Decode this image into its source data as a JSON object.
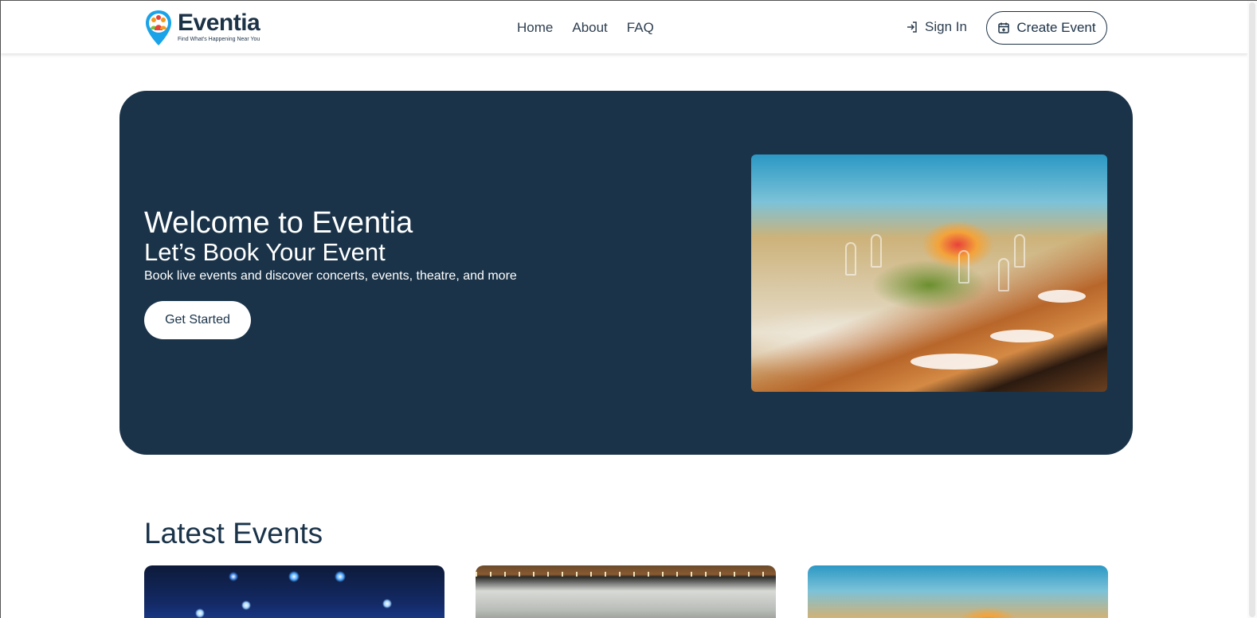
{
  "header": {
    "brand_name": "Eventia",
    "brand_tagline": "Find What's Happening Near You",
    "nav": [
      "Home",
      "About",
      "FAQ"
    ],
    "sign_in_label": "Sign In",
    "create_event_label": "Create Event"
  },
  "hero": {
    "title": "Welcome to Eventia",
    "subtitle": "Let’s Book Your Event",
    "description": "Book live events and discover concerts, events, theatre, and more",
    "cta_label": "Get Started",
    "image": "banquet-table-with-flowers"
  },
  "latest": {
    "title": "Latest Events",
    "cards": [
      "concert-stage-lights",
      "restaurant-event",
      "banquet-table-with-flowers"
    ]
  },
  "colors": {
    "primary": "#1a3349",
    "white": "#ffffff"
  }
}
